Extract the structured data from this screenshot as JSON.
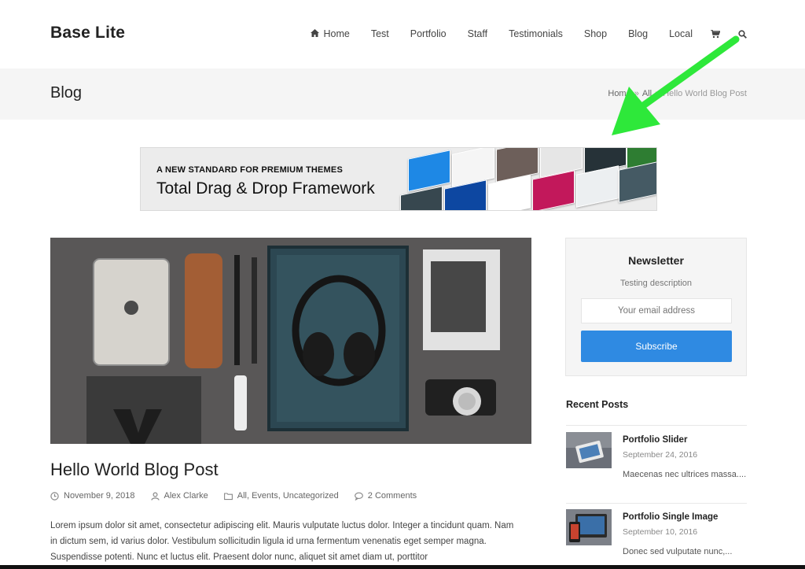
{
  "site": {
    "title": "Base Lite"
  },
  "nav": {
    "items": [
      "Home",
      "Test",
      "Portfolio",
      "Staff",
      "Testimonials",
      "Shop",
      "Blog",
      "Local"
    ],
    "home_icon": "home-icon",
    "cart_icon": "cart-icon",
    "search_icon": "search-icon"
  },
  "title_bar": {
    "title": "Blog",
    "breadcrumb": {
      "home": "Home",
      "sep": "»",
      "category": "All",
      "current": "Hello World Blog Post"
    }
  },
  "banner": {
    "kicker": "A NEW STANDARD FOR PREMIUM THEMES",
    "headline": "Total Drag & Drop Framework"
  },
  "post": {
    "title": "Hello World Blog Post",
    "date": "November 9, 2018",
    "author": "Alex Clarke",
    "categories": "All, Events, Uncategorized",
    "comments": "2 Comments",
    "excerpt": "Lorem ipsum dolor sit amet, consectetur adipiscing elit. Mauris vulputate luctus dolor. Integer a tincidunt quam. Nam in dictum sem, id varius dolor. Vestibulum sollicitudin ligula id urna fermentum venenatis eget semper magna. Suspendisse potenti. Nunc et luctus elit. Praesent dolor nunc, aliquet sit amet diam ut, porttitor"
  },
  "newsletter": {
    "title": "Newsletter",
    "description": "Testing description",
    "placeholder": "Your email address",
    "button": "Subscribe"
  },
  "recent_posts": {
    "heading": "Recent Posts",
    "items": [
      {
        "title": "Portfolio Slider",
        "date": "September 24, 2016",
        "excerpt": "Maecenas nec ultrices massa...."
      },
      {
        "title": "Portfolio Single Image",
        "date": "September 10, 2016",
        "excerpt": "Donec sed vulputate nunc,..."
      }
    ]
  },
  "colors": {
    "accent_blue": "#2f8ae2",
    "annotation_arrow": "#2ee83a",
    "title_bar_bg": "#f5f5f5"
  }
}
